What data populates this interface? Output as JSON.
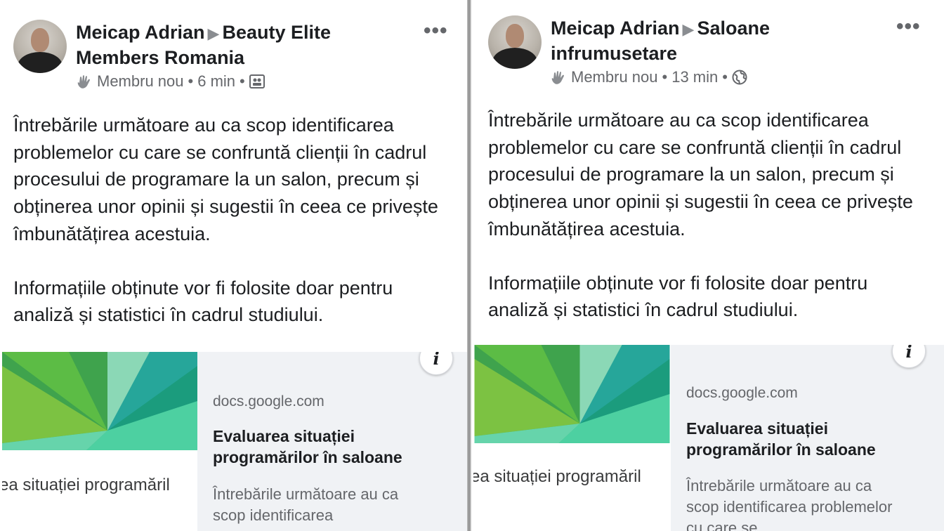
{
  "posts": [
    {
      "author": "Meicap Adrian",
      "group": "Beauty Elite Members Romania",
      "badge": "Membru nou",
      "time": "6 min",
      "privacy_icon": "group-icon",
      "paragraphs": [
        "Întrebările următoare au ca scop identificarea problemelor cu care se confruntă clienții în cadrul procesului de programare la un salon, precum și obținerea unor opinii și sugestii în ceea ce privește îmbunătățirea acestuia.",
        "Informațiile obținute vor fi folosite doar pentru analiză și statistici în cadrul studiului."
      ],
      "link_card": {
        "thumb_title": "ea situației programăril",
        "domain": "docs.google.com",
        "title": "Evaluarea situației programărilor în saloane",
        "description": "Întrebările următoare au ca scop identificarea"
      }
    },
    {
      "author": "Meicap Adrian",
      "group": "Saloane infrumusetare",
      "badge": "Membru nou",
      "time": "13 min",
      "privacy_icon": "globe-icon",
      "paragraphs": [
        "Întrebările următoare au ca scop identificarea problemelor cu care se confruntă clienții în cadrul procesului de programare la un salon, precum și obținerea unor opinii și sugestii în ceea ce privește îmbunătățirea acestuia.",
        "Informațiile obținute vor fi folosite doar pentru analiză și statistici în cadrul studiului."
      ],
      "link_card": {
        "thumb_title": "ea situației programăril",
        "domain": "docs.google.com",
        "title": "Evaluarea situației programărilor în saloane",
        "description": "Întrebările următoare au ca scop identificarea problemelor cu care se"
      }
    }
  ],
  "separator": "•",
  "more_label": "•••",
  "info_label": "i",
  "colors": {
    "text": "#1c1e21",
    "secondary": "#65676b",
    "card_bg": "#f0f2f5",
    "forms_green_dark": "#0f9d58",
    "forms_green_light": "#57bb8a"
  }
}
